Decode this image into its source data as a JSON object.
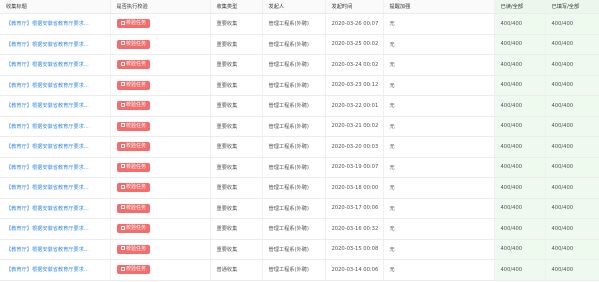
{
  "table": {
    "headers": [
      "收集标题",
      "是否执行校验",
      "收集类型",
      "发起人",
      "发起时间",
      "提醒加强",
      "已读/全部",
      "已填写/全部"
    ],
    "rows": [
      {
        "title": "【教育厅】根据安徽省教育厅要求...",
        "action": "校验任务",
        "type": "重要收集",
        "initiator": "管理工程系(外聘)",
        "time": "2020-03-26 00:07",
        "remind": "无",
        "read": "400/400",
        "filled": "400/400"
      },
      {
        "title": "【教育厅】根据安徽省教育厅要求...",
        "action": "校验任务",
        "type": "重要收集",
        "initiator": "管理工程系(外聘)",
        "time": "2020-03-25 00:02",
        "remind": "无",
        "read": "400/400",
        "filled": "400/400"
      },
      {
        "title": "【教育厅】根据安徽省教育厅要求...",
        "action": "校验任务",
        "type": "重要收集",
        "initiator": "管理工程系(外聘)",
        "time": "2020-03-24 00:02",
        "remind": "无",
        "read": "400/400",
        "filled": "400/400"
      },
      {
        "title": "【教育厅】根据安徽省教育厅要求...",
        "action": "校验任务",
        "type": "重要收集",
        "initiator": "管理工程系(外聘)",
        "time": "2020-03-23 00:12",
        "remind": "无",
        "read": "400/400",
        "filled": "400/400"
      },
      {
        "title": "【教育厅】根据安徽省教育厅要求...",
        "action": "校验任务",
        "type": "重要收集",
        "initiator": "管理工程系(外聘)",
        "time": "2020-03-22 00:01",
        "remind": "无",
        "read": "400/400",
        "filled": "400/400"
      },
      {
        "title": "【教育厅】根据安徽省教育厅要求...",
        "action": "校验任务",
        "type": "重要收集",
        "initiator": "管理工程系(外聘)",
        "time": "2020-03-21 00:02",
        "remind": "无",
        "read": "400/400",
        "filled": "400/400"
      },
      {
        "title": "【教育厅】根据安徽省教育厅要求...",
        "action": "校验任务",
        "type": "重要收集",
        "initiator": "管理工程系(外聘)",
        "time": "2020-03-20 00:03",
        "remind": "无",
        "read": "400/400",
        "filled": "400/400"
      },
      {
        "title": "【教育厅】根据安徽省教育厅要求...",
        "action": "校验任务",
        "type": "重要收集",
        "initiator": "管理工程系(外聘)",
        "time": "2020-03-19 00:07",
        "remind": "无",
        "read": "400/400",
        "filled": "400/400"
      },
      {
        "title": "【教育厅】根据安徽省教育厅要求...",
        "action": "校验任务",
        "type": "重要收集",
        "initiator": "管理工程系(外聘)",
        "time": "2020-03-18 00:00",
        "remind": "无",
        "read": "400/400",
        "filled": "400/400"
      },
      {
        "title": "【教育厅】根据安徽省教育厅要求...",
        "action": "校验任务",
        "type": "重要收集",
        "initiator": "管理工程系(外聘)",
        "time": "2020-03-17 00:06",
        "remind": "无",
        "read": "400/400",
        "filled": "400/400"
      },
      {
        "title": "【教育厅】根据安徽省教育厅要求...",
        "action": "校验任务",
        "type": "重要收集",
        "initiator": "管理工程系(外聘)",
        "time": "2020-03-16 00:32",
        "remind": "无",
        "read": "400/400",
        "filled": "400/400"
      },
      {
        "title": "【教育厅】根据安徽省教育厅要求...",
        "action": "校验任务",
        "type": "重要收集",
        "initiator": "管理工程系(外聘)",
        "time": "2020-03-15 00:08",
        "remind": "无",
        "read": "400/400",
        "filled": "400/400"
      },
      {
        "title": "【教育厅】根据安徽省教育厅要求...",
        "action": "校验任务",
        "type": "普通收集",
        "initiator": "管理工程系(外聘)",
        "time": "2020-03-14 00:06",
        "remind": "无",
        "read": "400/400",
        "filled": "400/400"
      }
    ]
  },
  "colors": {
    "accent": "#3a8ee6",
    "action_button": "#f56c6c",
    "read_column_bg": "#effaef"
  },
  "icons": {
    "action_button_icon": "task-icon"
  }
}
